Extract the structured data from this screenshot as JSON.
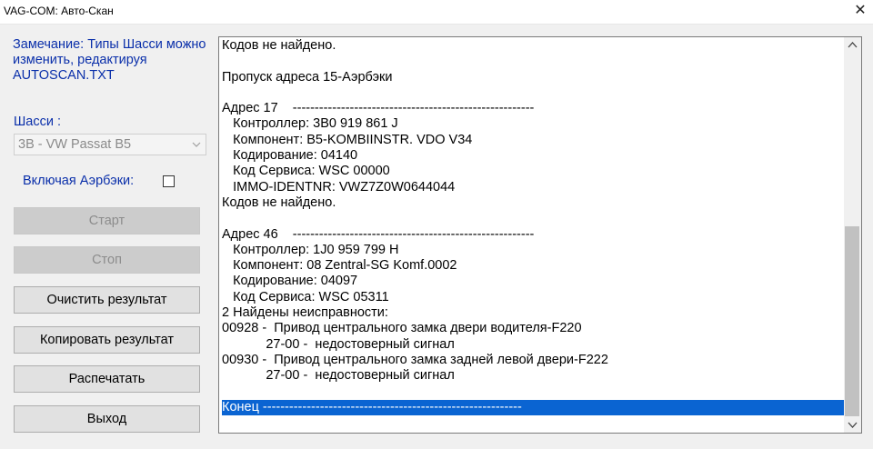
{
  "window": {
    "title": "VAG-COM: Авто-Скан",
    "close_glyph": "✕"
  },
  "sidebar": {
    "note": "Замечание: Типы Шасси можно\nизменить, редактируя\nAUTOSCAN.TXT",
    "chassis_label": "Шасси :",
    "chassis_value": "3B - VW Passat B5",
    "airbag_label": "Включая Аэрбэки:",
    "airbag_checked": false,
    "buttons": {
      "start": "Старт",
      "stop": "Стоп",
      "clear": "Очистить результат",
      "copy": "Копировать результат",
      "print": "Распечатать",
      "exit": "Выход"
    }
  },
  "results": {
    "lines": [
      "Кодов не найдено.",
      "",
      "Пропуск адреса 15-Аэрбэки",
      "",
      "Адрес 17    -------------------------------------------------------",
      "   Контроллер: 3B0 919 861 J",
      "   Компонент: B5-KOMBIINSTR. VDO V34",
      "   Кодирование: 04140",
      "   Код Сервиса: WSC 00000",
      "   IMMO-IDENTNR: VWZ7Z0W0644044",
      "Кодов не найдено.",
      "",
      "Адрес 46    -------------------------------------------------------",
      "   Контроллер: 1J0 959 799 H",
      "   Компонент: 08 Zentral-SG Komf.0002",
      "   Кодирование: 04097",
      "   Код Сервиса: WSC 05311",
      "2 Найдены неисправности:",
      "00928 -  Привод центрального замка двери водителя-F220",
      "            27-00 -  недостоверный сигнал",
      "00930 -  Привод центрального замка задней левой двери-F222",
      "            27-00 -  недостоверный сигнал",
      "",
      "Конец -----------------------------------------------------------"
    ],
    "selected_line_index": 23
  },
  "colors": {
    "label_blue": "#0a2faa",
    "selection": "#0a64d2"
  }
}
